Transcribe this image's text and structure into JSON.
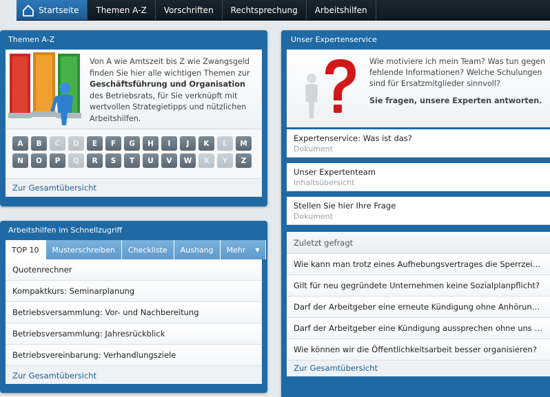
{
  "nav": {
    "home": "Startseite",
    "items": [
      "Themen A-Z",
      "Vorschriften",
      "Rechtsprechung",
      "Arbeitshilfen"
    ]
  },
  "themen": {
    "title": "Themen A-Z",
    "intro_1": "Von A wie Amtszeit bis Z wie Zwangsgeld finden Sie hier alle wichtigen Themen zur ",
    "intro_bold": "Geschäftsführung und Organisation",
    "intro_2": " des Betriebsrats, für Sie verknüpft mit wertvollen Strategietipps und nützlichen Arbeitshilfen.",
    "letters_row1": [
      {
        "l": "A",
        "on": true
      },
      {
        "l": "B",
        "on": true
      },
      {
        "l": "C",
        "on": false
      },
      {
        "l": "D",
        "on": false
      },
      {
        "l": "E",
        "on": true
      },
      {
        "l": "F",
        "on": true
      },
      {
        "l": "G",
        "on": true
      },
      {
        "l": "H",
        "on": true
      },
      {
        "l": "I",
        "on": true
      },
      {
        "l": "J",
        "on": true
      },
      {
        "l": "K",
        "on": true
      },
      {
        "l": "L",
        "on": false
      },
      {
        "l": "M",
        "on": true
      }
    ],
    "letters_row2": [
      {
        "l": "N",
        "on": true
      },
      {
        "l": "O",
        "on": true
      },
      {
        "l": "P",
        "on": true
      },
      {
        "l": "Q",
        "on": false
      },
      {
        "l": "R",
        "on": true
      },
      {
        "l": "S",
        "on": true
      },
      {
        "l": "T",
        "on": true
      },
      {
        "l": "U",
        "on": true
      },
      {
        "l": "V",
        "on": true
      },
      {
        "l": "W",
        "on": true
      },
      {
        "l": "X",
        "on": false
      },
      {
        "l": "Y",
        "on": false
      },
      {
        "l": "Z",
        "on": true
      }
    ],
    "more": "Zur Gesamtübersicht"
  },
  "arbeitshilfen": {
    "title": "Arbeitshilfen im Schnellzugriff",
    "tabs": [
      "TOP 10",
      "Musterschreiben",
      "Checkliste",
      "Aushang",
      "Mehr"
    ],
    "items": [
      "Quotenrechner",
      "Kompaktkurs: Seminarplanung",
      "Betriebsversammlung: Vor- und Nachbereitung",
      "Betriebsversammlung: Jahresrückblick",
      "Betriebsvereinbarung: Verhandlungsziele"
    ],
    "more": "Zur Gesamtübersicht"
  },
  "experten": {
    "title": "Unser Expertenservice",
    "intro": "Wie motiviere ich mein Team? Was tun gegen fehlende Informationen? Welche Schulungen sind für Ersatzmitglieder sinnvoll?",
    "intro_bold": "Sie fragen, unsere Experten antworten.",
    "cards": [
      {
        "title": "Expertenservice: Was ist das?",
        "sub": "Dokument"
      },
      {
        "title": "Unser Expertenteam",
        "sub": "Inhaltsübersicht"
      },
      {
        "title": "Stellen Sie hier Ihre Frage",
        "sub": "Dokument"
      }
    ],
    "zuletzt_title": "Zuletzt gefragt",
    "zuletzt": [
      "Wie kann man trotz eines Aufhebungsvertrages die Sperrzeit vermeiden?",
      "Gilt für neu gegründete Unternehmen keine Sozialplanpflicht?",
      "Darf der Arbeitgeber eine erneute Kündigung ohne Anhörung aussprechen?",
      "Darf der Arbeitgeber eine Kündigung aussprechen ohne uns zu informieren?",
      "Wie können wir die Öffentlichkeitsarbeit besser organisieren?"
    ],
    "more": "Zur Gesamtübersicht"
  }
}
